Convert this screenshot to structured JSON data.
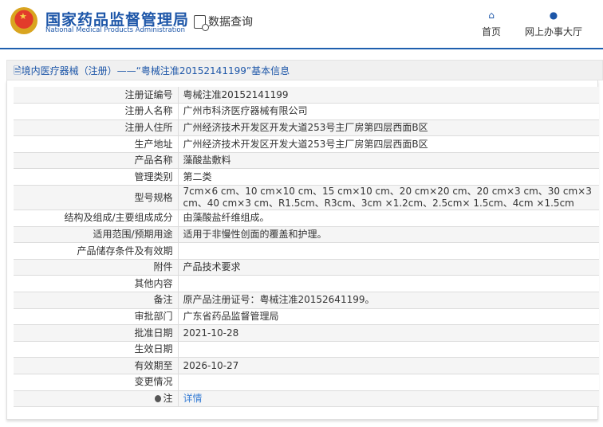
{
  "header": {
    "title_cn": "国家药品监督管理局",
    "title_en": "National Medical Products Administration",
    "data_query": "数据查询",
    "nav": [
      {
        "icon": "home-icon",
        "label": "首页"
      },
      {
        "icon": "user-icon",
        "label": "网上办事大厅"
      }
    ]
  },
  "page_title": "境内医疗器械（注册）——“粤械注准20152141199”基本信息",
  "rows": [
    {
      "label": "注册证编号",
      "value": "粤械注准20152141199"
    },
    {
      "label": "注册人名称",
      "value": "广州市科济医疗器械有限公司"
    },
    {
      "label": "注册人住所",
      "value": "广州经济技术开发区开发大道253号主厂房第四层西面B区"
    },
    {
      "label": "生产地址",
      "value": "广州经济技术开发区开发大道253号主厂房第四层西面B区"
    },
    {
      "label": "产品名称",
      "value": "藻酸盐敷料"
    },
    {
      "label": "管理类别",
      "value": "第二类"
    },
    {
      "label": "型号规格",
      "value": "7cm×6 cm、10 cm×10 cm、15 cm×10 cm、20 cm×20 cm、20 cm×3 cm、30 cm×3 cm、40 cm×3 cm、R1.5cm、R3cm、3cm ×1.2cm、2.5cm× 1.5cm、4cm ×1.5cm"
    },
    {
      "label": "结构及组成/主要组成成分",
      "value": "由藻酸盐纤维组成。"
    },
    {
      "label": "适用范围/预期用途",
      "value": "适用于非慢性创面的覆盖和护理。"
    },
    {
      "label": "产品储存条件及有效期",
      "value": ""
    },
    {
      "label": "附件",
      "value": "产品技术要求"
    },
    {
      "label": "其他内容",
      "value": ""
    },
    {
      "label": "备注",
      "value": "原产品注册证号：粤械注准20152641199。"
    },
    {
      "label": "审批部门",
      "value": "广东省药品监督管理局"
    },
    {
      "label": "批准日期",
      "value": "2021-10-28"
    },
    {
      "label": "生效日期",
      "value": ""
    },
    {
      "label": "有效期至",
      "value": "2026-10-27"
    },
    {
      "label": "变更情况",
      "value": ""
    },
    {
      "label": "注",
      "value": "详情"
    }
  ]
}
